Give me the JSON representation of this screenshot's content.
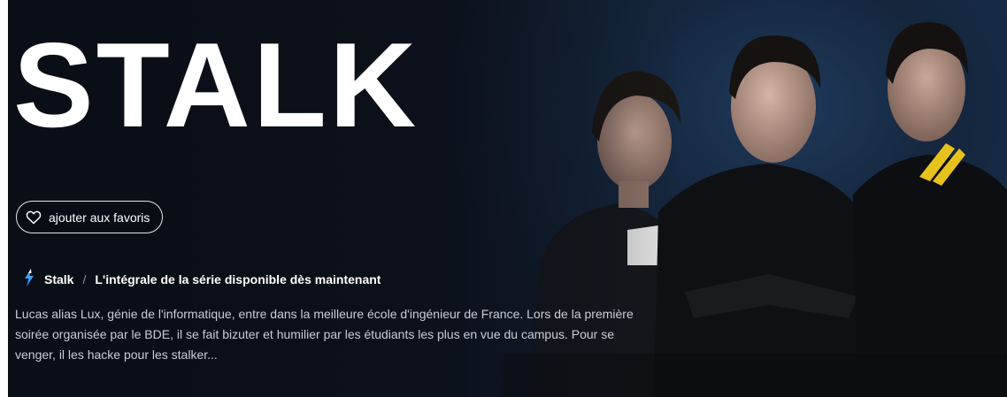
{
  "hero": {
    "title": "STALK",
    "favorite_button": {
      "label": "ajouter aux favoris",
      "icon": "heart-outline-icon"
    },
    "meta": {
      "channel_icon": "channel-logo-icon",
      "show": "Stalk",
      "separator": "/",
      "subtitle": "L'intégrale de la série disponible dès maintenant"
    },
    "synopsis": "Lucas alias Lux, génie de l'informatique, entre dans la meilleure école d'ingénieur de France. Lors de la première soirée organisée par le BDE, il se fait bizuter et humilier par les étudiants les plus en vue du campus. Pour se venger, il les hacke pour les stalker..."
  },
  "colors": {
    "background_dark": "#0c111a",
    "background_blue": "#16304c",
    "text_primary": "#ffffff",
    "text_secondary": "#c9ced6",
    "jacket_stripe": "#e8c21c",
    "channel_logo": "#3aa0ff"
  }
}
